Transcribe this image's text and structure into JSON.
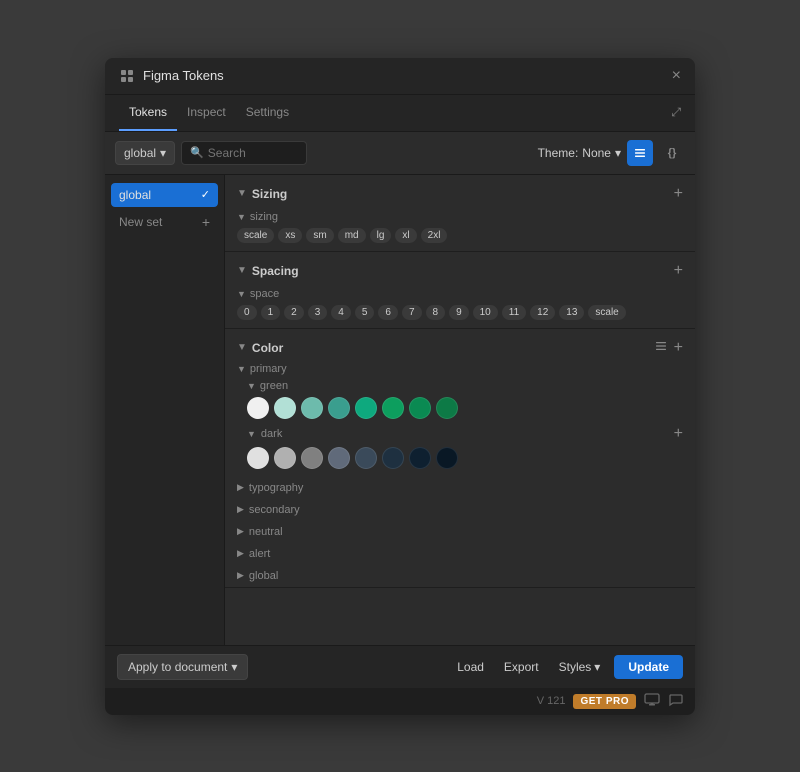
{
  "window": {
    "title": "Figma Tokens",
    "close_label": "×"
  },
  "tabs": [
    {
      "label": "Tokens",
      "active": true
    },
    {
      "label": "Inspect",
      "active": false
    },
    {
      "label": "Settings",
      "active": false
    }
  ],
  "toolbar": {
    "global_label": "global",
    "search_placeholder": "Search",
    "theme_label": "Theme:",
    "theme_value": "None"
  },
  "sidebar": {
    "global_item": "global",
    "new_set_label": "New set"
  },
  "sizing": {
    "section_title": "Sizing",
    "subsection_label": "sizing",
    "tags": [
      "scale",
      "xs",
      "sm",
      "md",
      "lg",
      "xl",
      "2xl"
    ]
  },
  "spacing": {
    "section_title": "Spacing",
    "subsection_label": "space",
    "tags": [
      "0",
      "1",
      "2",
      "3",
      "4",
      "5",
      "6",
      "7",
      "8",
      "9",
      "10",
      "11",
      "12",
      "13",
      "scale"
    ]
  },
  "color": {
    "section_title": "Color",
    "primary_label": "primary",
    "green_label": "green",
    "dark_label": "dark",
    "green_swatches": [
      "#f0f0f0",
      "#b2e0d6",
      "#6dbbac",
      "#3a9e8e",
      "#0ea97e",
      "#0d9e5e",
      "#0a8a52",
      "#0d7a46"
    ],
    "dark_swatches": [
      "#e0e0e0",
      "#b0b0b0",
      "#808080",
      "#606a7a",
      "#3a4a5a",
      "#1e3040",
      "#0e2030",
      "#091825"
    ],
    "collapsed_items": [
      "typography",
      "secondary",
      "neutral",
      "alert",
      "global"
    ]
  },
  "bottom": {
    "apply_label": "Apply to document",
    "load_label": "Load",
    "export_label": "Export",
    "styles_label": "Styles",
    "update_label": "Update"
  },
  "version_bar": {
    "version": "V 121",
    "get_pro": "GET PRO"
  }
}
